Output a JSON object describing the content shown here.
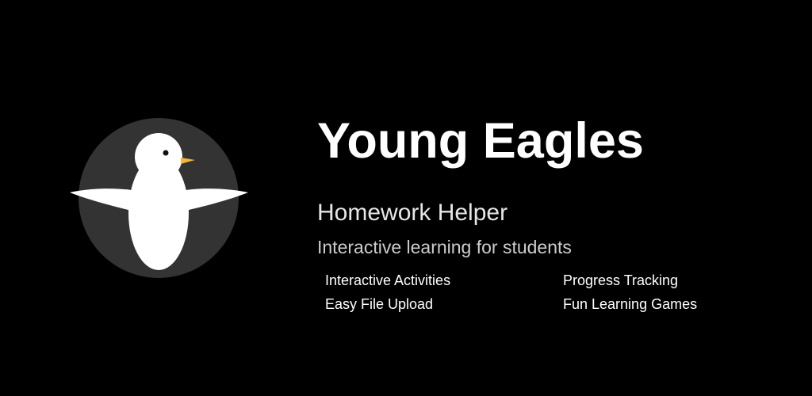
{
  "brand": {
    "title": "Young Eagles",
    "subtitle": "Homework Helper",
    "tagline": "Interactive learning for students",
    "logo_icon": "eagle-icon"
  },
  "features": [
    "Interactive Activities",
    "Progress Tracking",
    "Easy File Upload",
    "Fun Learning Games"
  ],
  "colors": {
    "background": "#000000",
    "logo_circle": "#333333",
    "bird_body": "#ffffff",
    "beak": "#f2b53a",
    "text": "#ffffff"
  }
}
